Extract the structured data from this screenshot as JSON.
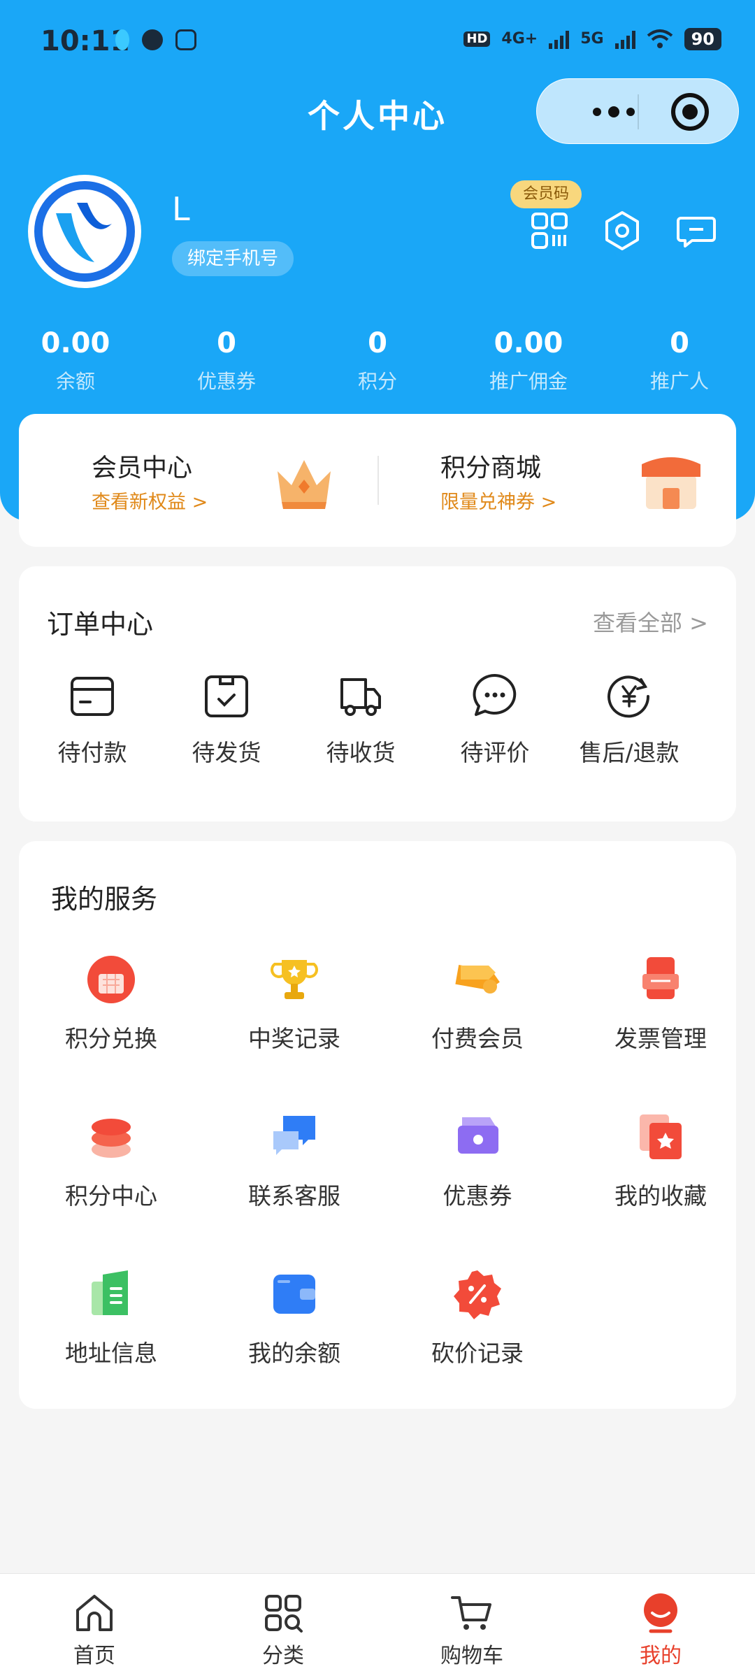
{
  "status_bar": {
    "time": "10:11",
    "network_1": "4G+",
    "network_2": "5G",
    "battery": "90"
  },
  "header": {
    "title": "个人中心"
  },
  "profile": {
    "username": "L",
    "bind_phone": "绑定手机号",
    "member_code": "会员码"
  },
  "stats": [
    {
      "value": "0.00",
      "label": "余额"
    },
    {
      "value": "0",
      "label": "优惠券"
    },
    {
      "value": "0",
      "label": "积分"
    },
    {
      "value": "0.00",
      "label": "推广佣金"
    },
    {
      "value": "0",
      "label": "推广人"
    }
  ],
  "promo": {
    "left": {
      "title": "会员中心",
      "subtitle": "查看新权益 >"
    },
    "right": {
      "title": "积分商城",
      "subtitle": "限量兑神券 >"
    }
  },
  "orders": {
    "title": "订单中心",
    "view_all": "查看全部 >",
    "items": [
      {
        "label": "待付款",
        "icon": "wallet-icon"
      },
      {
        "label": "待发货",
        "icon": "package-check-icon"
      },
      {
        "label": "待收货",
        "icon": "delivery-truck-icon"
      },
      {
        "label": "待评价",
        "icon": "chat-bubble-icon"
      },
      {
        "label": "售后/退款",
        "icon": "yuan-refund-icon"
      }
    ]
  },
  "services": {
    "title": "我的服务",
    "items": [
      {
        "label": "积分兑换",
        "icon": "points-exchange-icon"
      },
      {
        "label": "中奖记录",
        "icon": "trophy-icon"
      },
      {
        "label": "付费会员",
        "icon": "vip-tag-icon"
      },
      {
        "label": "发票管理",
        "icon": "invoice-icon"
      },
      {
        "label": "积分中心",
        "icon": "coins-stack-icon"
      },
      {
        "label": "联系客服",
        "icon": "customer-service-icon"
      },
      {
        "label": "优惠券",
        "icon": "coupon-icon"
      },
      {
        "label": "我的收藏",
        "icon": "favorites-icon"
      },
      {
        "label": "地址信息",
        "icon": "address-book-icon"
      },
      {
        "label": "我的余额",
        "icon": "wallet-balance-icon"
      },
      {
        "label": "砍价记录",
        "icon": "discount-badge-icon"
      }
    ]
  },
  "tabbar": [
    {
      "label": "首页",
      "icon": "home-icon"
    },
    {
      "label": "分类",
      "icon": "category-icon"
    },
    {
      "label": "购物车",
      "icon": "cart-icon"
    },
    {
      "label": "我的",
      "icon": "profile-icon",
      "active": true
    }
  ],
  "colors": {
    "primary_blue": "#1aa7f7",
    "accent_orange": "#e0891a",
    "active_red": "#e8402b"
  }
}
